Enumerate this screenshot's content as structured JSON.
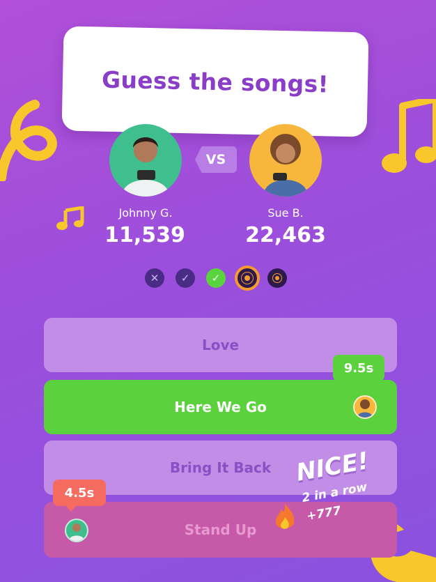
{
  "prompt": {
    "text": "Guess the songs!"
  },
  "players": [
    {
      "name": "Johnny G.",
      "score": "11,539"
    },
    {
      "name": "Sue B.",
      "score": "22,463"
    }
  ],
  "vs_label": "VS",
  "rounds": [
    "close-icon",
    "check-icon",
    "check-icon",
    "vinyl-icon",
    "vinyl-icon"
  ],
  "answers": [
    {
      "label": "Love"
    },
    {
      "label": "Here We Go"
    },
    {
      "label": "Bring It Back"
    },
    {
      "label": "Stand Up"
    }
  ],
  "timers": {
    "opponent": "9.5s",
    "player": "4.5s"
  },
  "celebration": {
    "headline": "NICE!",
    "streak": "2 in a row",
    "bonus": "+777"
  },
  "colors": {
    "correct": "#5bd13d",
    "wrong": "#c65aa8",
    "accent": "#f59a2e"
  }
}
